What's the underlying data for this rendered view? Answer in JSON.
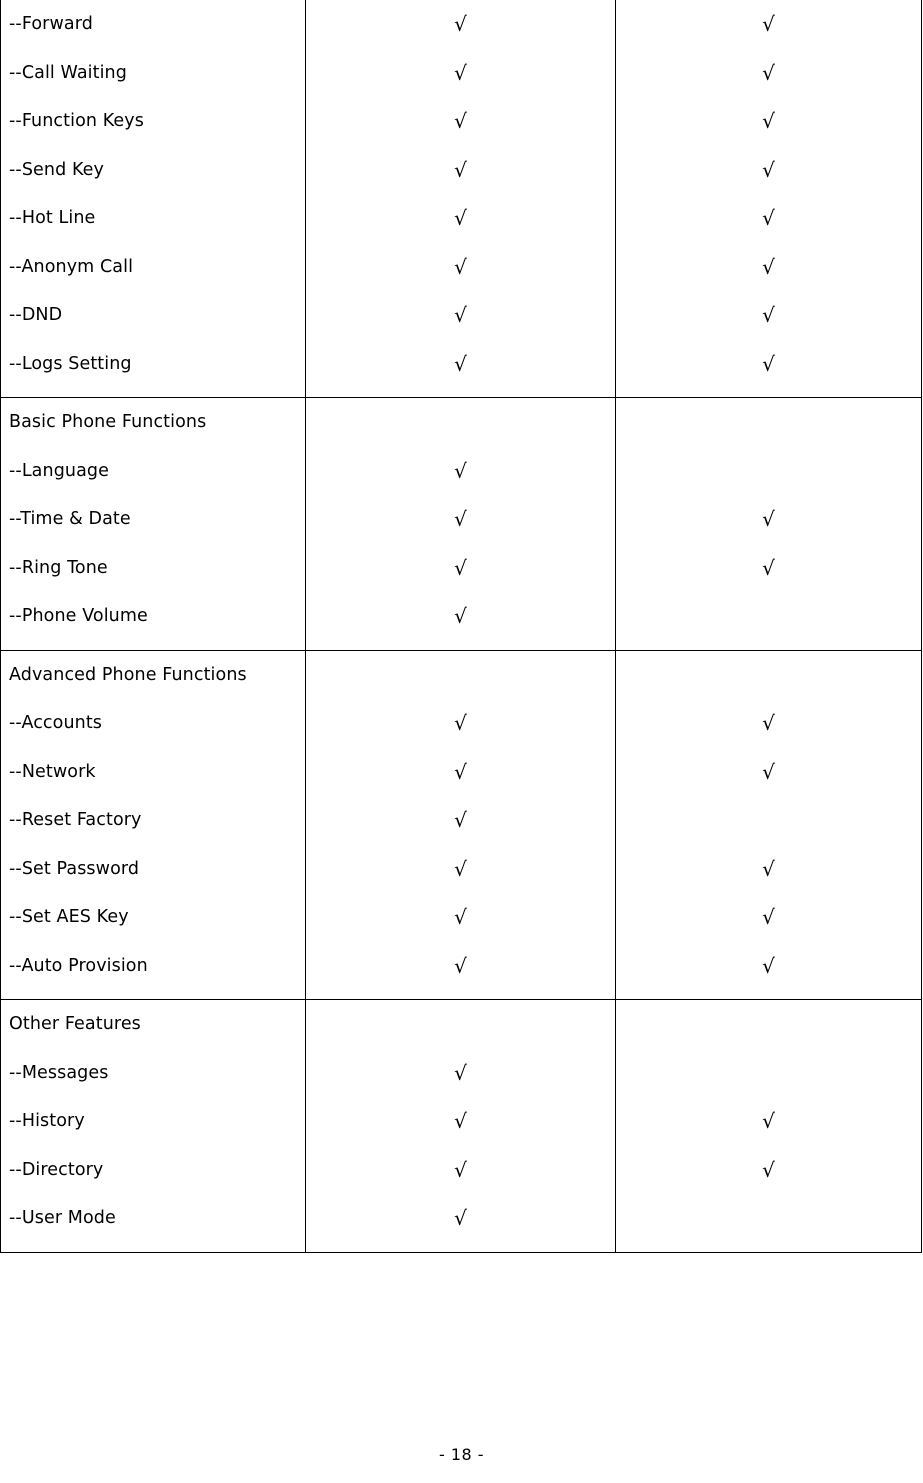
{
  "document": {
    "page_footer": "- 18 -"
  },
  "table": {
    "check_mark": "√",
    "blank": "",
    "sections": [
      {
        "section_name": "continued-call-features",
        "heading": null,
        "rows": [
          {
            "label": "--Forward",
            "col2": "√",
            "col3": "√"
          },
          {
            "label": "--Call Waiting",
            "col2": "√",
            "col3": "√"
          },
          {
            "label": "--Function Keys",
            "col2": "√",
            "col3": "√"
          },
          {
            "label": "--Send Key",
            "col2": "√",
            "col3": "√"
          },
          {
            "label": "--Hot Line",
            "col2": "√",
            "col3": "√"
          },
          {
            "label": "--Anonym Call",
            "col2": "√",
            "col3": "√"
          },
          {
            "label": "--DND",
            "col2": "√",
            "col3": "√"
          },
          {
            "label": "--Logs Setting",
            "col2": "√",
            "col3": "√"
          }
        ]
      },
      {
        "section_name": "basic-phone-functions",
        "heading": "Basic Phone Functions",
        "rows": [
          {
            "label": "--Language",
            "col2": "√",
            "col3": ""
          },
          {
            "label": "--Time & Date",
            "col2": "√",
            "col3": "√"
          },
          {
            "label": "--Ring Tone",
            "col2": "√",
            "col3": "√"
          },
          {
            "label": "--Phone Volume",
            "col2": "√",
            "col3": ""
          }
        ]
      },
      {
        "section_name": "advanced-phone-functions",
        "heading": "Advanced Phone Functions",
        "rows": [
          {
            "label": "--Accounts",
            "col2": "√",
            "col3": "√"
          },
          {
            "label": "--Network",
            "col2": "√",
            "col3": "√"
          },
          {
            "label": "--Reset Factory",
            "col2": "√",
            "col3": ""
          },
          {
            "label": "--Set Password",
            "col2": "√",
            "col3": "√"
          },
          {
            "label": "--Set AES Key",
            "col2": "√",
            "col3": "√"
          },
          {
            "label": "--Auto Provision",
            "col2": "√",
            "col3": "√"
          }
        ]
      },
      {
        "section_name": "other-features",
        "heading": "Other Features",
        "rows": [
          {
            "label": "--Messages",
            "col2": "√",
            "col3": ""
          },
          {
            "label": "--History",
            "col2": "√",
            "col3": "√"
          },
          {
            "label": "--Directory",
            "col2": "√",
            "col3": "√"
          },
          {
            "label": "--User Mode",
            "col2": "√",
            "col3": ""
          }
        ]
      }
    ]
  }
}
